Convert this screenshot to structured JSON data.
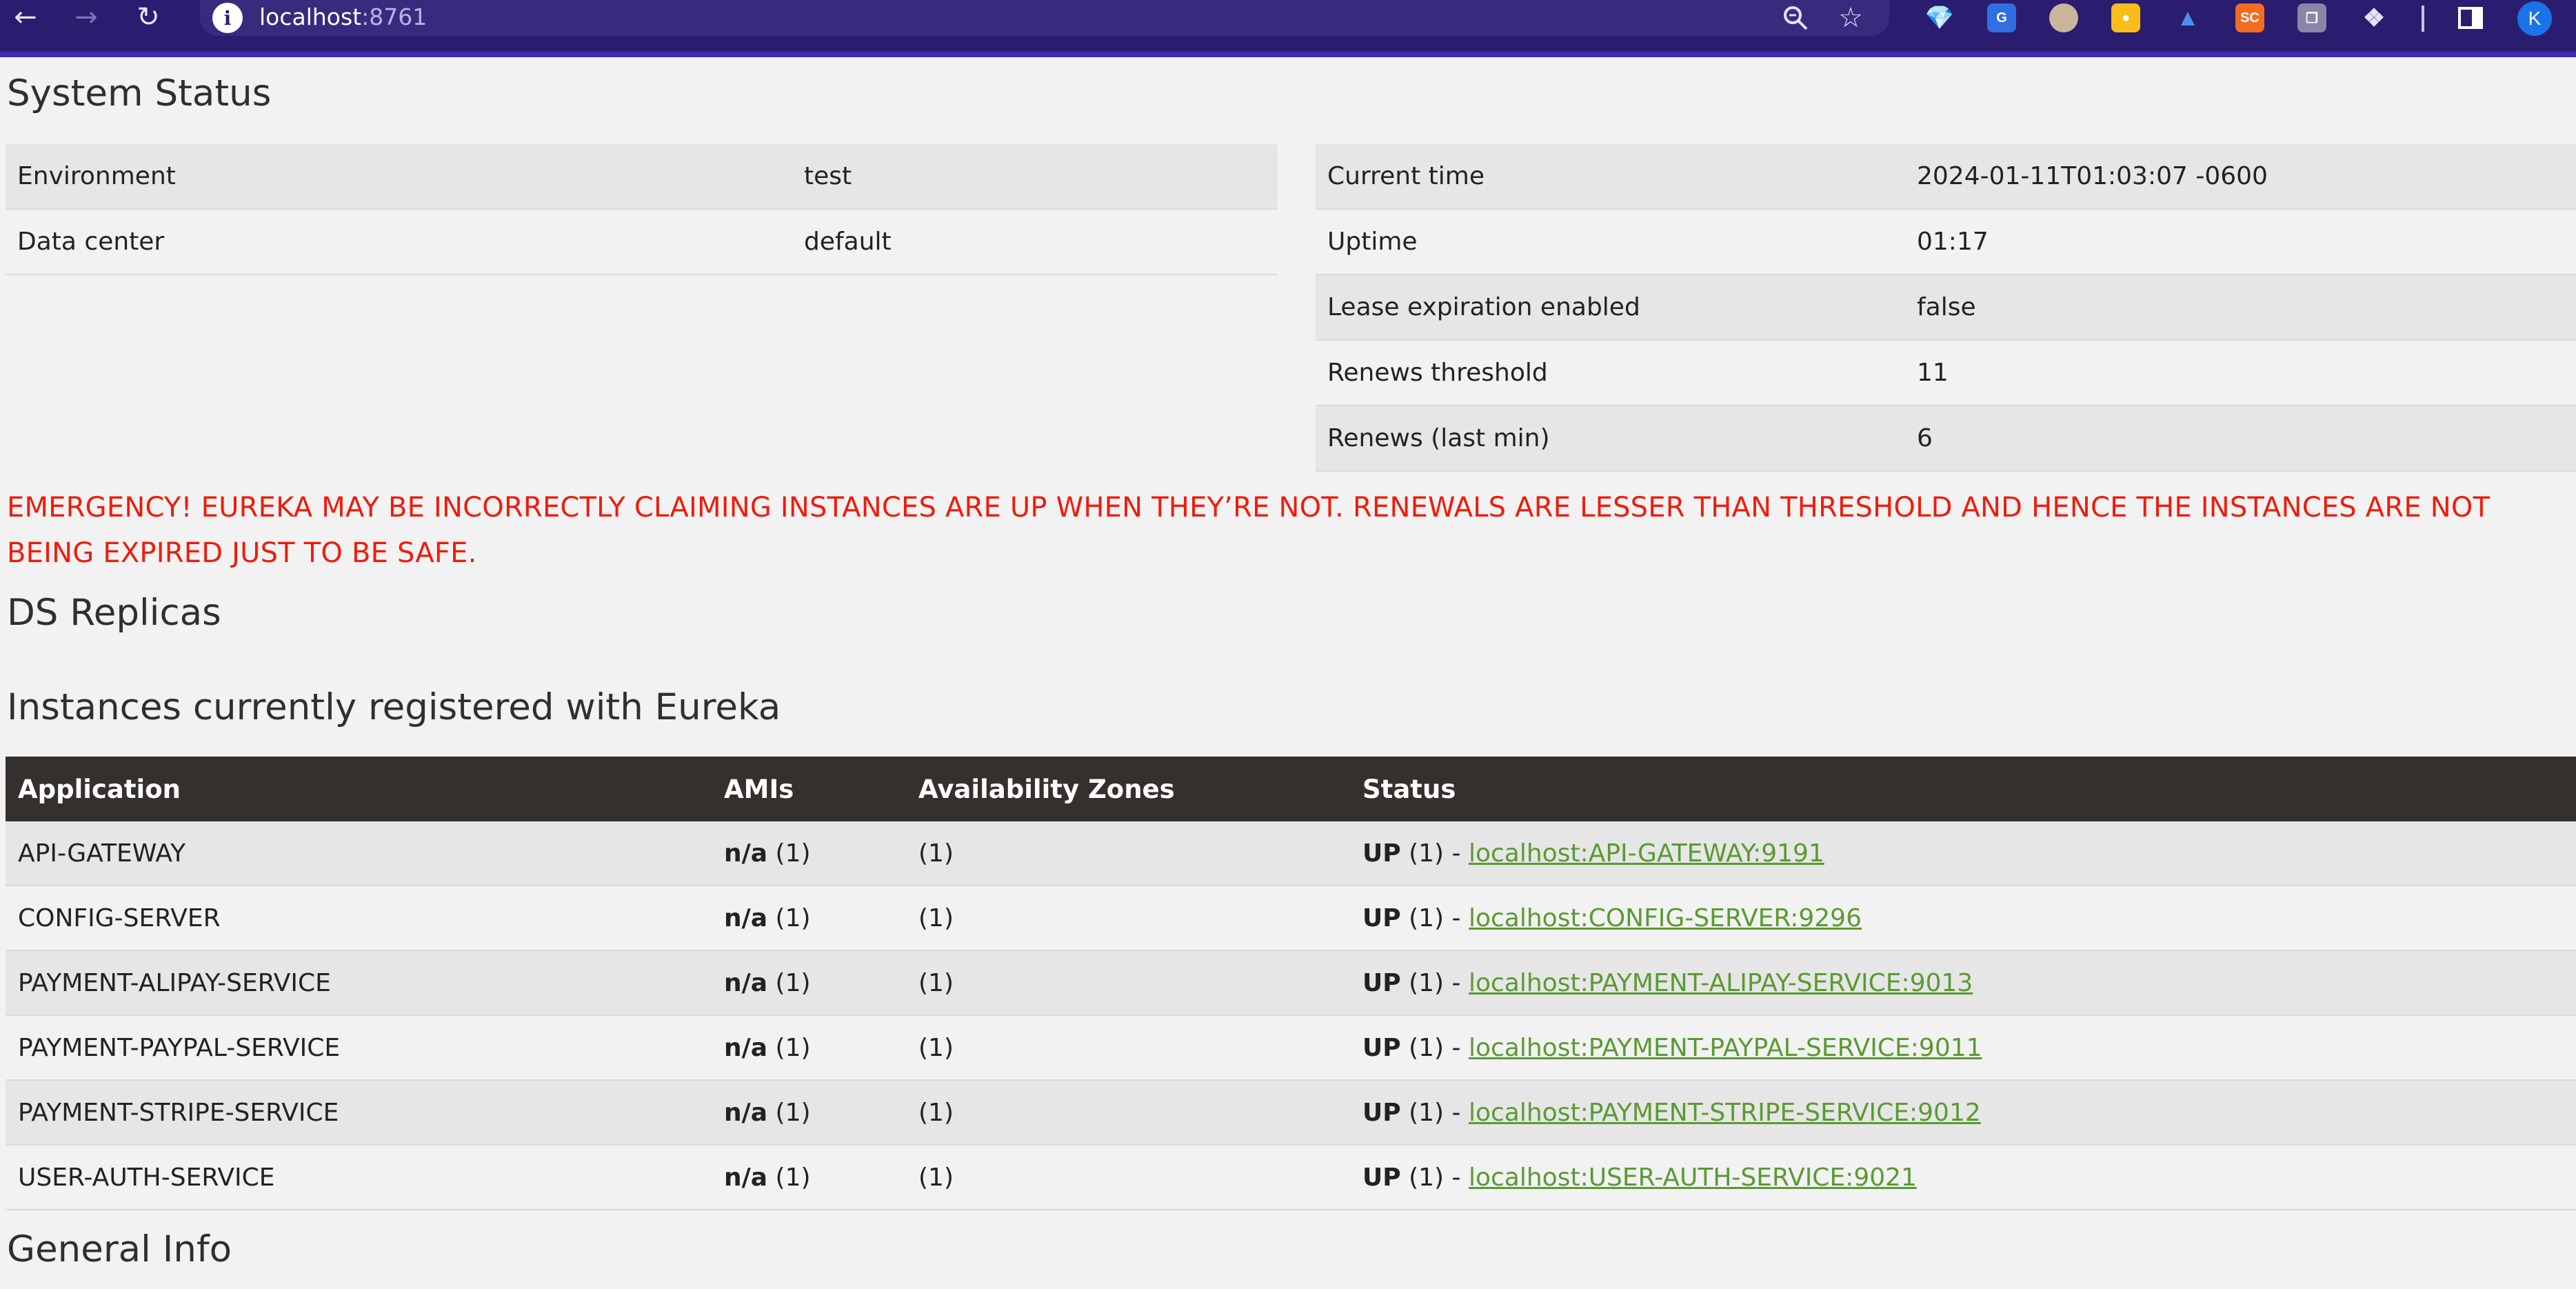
{
  "browser": {
    "url_host": "localhost",
    "url_port": ":8761",
    "profile_initial": "K",
    "colors": {
      "toolbar": "#2a1c6e",
      "omnibox": "#382b7e"
    }
  },
  "system_status": {
    "title": "System Status",
    "left": [
      {
        "label": "Environment",
        "value": "test"
      },
      {
        "label": "Data center",
        "value": "default"
      }
    ],
    "right": [
      {
        "label": "Current time",
        "value": "2024-01-11T01:03:07 -0600"
      },
      {
        "label": "Uptime",
        "value": "01:17"
      },
      {
        "label": "Lease expiration enabled",
        "value": "false"
      },
      {
        "label": "Renews threshold",
        "value": "11"
      },
      {
        "label": "Renews (last min)",
        "value": "6"
      }
    ]
  },
  "emergency": {
    "text": "EMERGENCY! EUREKA MAY BE INCORRECTLY CLAIMING INSTANCES ARE UP WHEN THEY’RE NOT. RENEWALS ARE LESSER THAN THRESHOLD AND HENCE THE INSTANCES ARE NOT BEING EXPIRED JUST TO BE SAFE.",
    "color": "#ee1c0c"
  },
  "ds_replicas": {
    "title": "DS Replicas"
  },
  "instances": {
    "title": "Instances currently registered with Eureka",
    "headers": {
      "application": "Application",
      "amis": "AMIs",
      "zones": "Availability Zones",
      "status": "Status"
    },
    "rows": [
      {
        "application": "API-GATEWAY",
        "ami": "n/a",
        "ami_count": "(1)",
        "zones": "(1)",
        "status": "UP",
        "status_count": "(1) -",
        "link": "localhost:API-GATEWAY:9191"
      },
      {
        "application": "CONFIG-SERVER",
        "ami": "n/a",
        "ami_count": "(1)",
        "zones": "(1)",
        "status": "UP",
        "status_count": "(1) -",
        "link": "localhost:CONFIG-SERVER:9296"
      },
      {
        "application": "PAYMENT-ALIPAY-SERVICE",
        "ami": "n/a",
        "ami_count": "(1)",
        "zones": "(1)",
        "status": "UP",
        "status_count": "(1) -",
        "link": "localhost:PAYMENT-ALIPAY-SERVICE:9013"
      },
      {
        "application": "PAYMENT-PAYPAL-SERVICE",
        "ami": "n/a",
        "ami_count": "(1)",
        "zones": "(1)",
        "status": "UP",
        "status_count": "(1) -",
        "link": "localhost:PAYMENT-PAYPAL-SERVICE:9011"
      },
      {
        "application": "PAYMENT-STRIPE-SERVICE",
        "ami": "n/a",
        "ami_count": "(1)",
        "zones": "(1)",
        "status": "UP",
        "status_count": "(1) -",
        "link": "localhost:PAYMENT-STRIPE-SERVICE:9012"
      },
      {
        "application": "USER-AUTH-SERVICE",
        "ami": "n/a",
        "ami_count": "(1)",
        "zones": "(1)",
        "status": "UP",
        "status_count": "(1) -",
        "link": "localhost:USER-AUTH-SERVICE:9021"
      }
    ],
    "link_color": "#5a9a32"
  },
  "general_info": {
    "title": "General Info"
  }
}
